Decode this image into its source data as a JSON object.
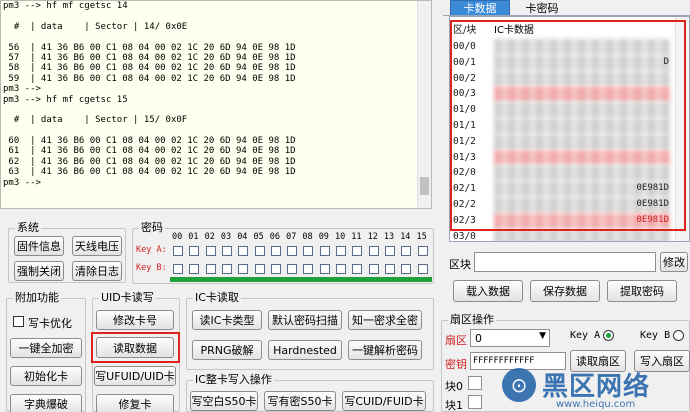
{
  "terminal": {
    "lines": [
      "pm3 --> hf mf cgetsc 14",
      "",
      "  #  | data    | Sector | 14/ 0x0E",
      "",
      " 56  | 41 36 B6 00 C1 08 04 00 02 1C 20 6D 94 0E 98 1D",
      " 57  | 41 36 B6 00 C1 08 04 00 02 1C 20 6D 94 0E 98 1D",
      " 58  | 41 36 B6 00 C1 08 04 00 02 1C 20 6D 94 0E 98 1D",
      " 59  | 41 36 B6 00 C1 08 04 00 02 1C 20 6D 94 0E 98 1D",
      "pm3 -->",
      "pm3 --> hf mf cgetsc 15",
      "",
      "  #  | data    | Sector | 15/ 0x0F",
      "",
      " 60  | 41 36 B6 00 C1 08 04 00 02 1C 20 6D 94 0E 98 1D",
      " 61  | 41 36 B6 00 C1 08 04 00 02 1C 20 6D 94 0E 98 1D",
      " 62  | 41 36 B6 00 C1 08 04 00 02 1C 20 6D 94 0E 98 1D",
      " 63  | 41 36 B6 00 C1 08 04 00 02 1C 20 6D 94 0E 98 1D",
      "pm3 -->",
      ""
    ]
  },
  "system": {
    "title": "系统",
    "btn_firmware": "固件信息",
    "btn_antenna": "天线电压",
    "btn_forceclose": "强制关闭",
    "btn_clearlog": "清除日志"
  },
  "password": {
    "title": "密码",
    "numbers": [
      "00",
      "01",
      "02",
      "03",
      "04",
      "05",
      "06",
      "07",
      "08",
      "09",
      "10",
      "11",
      "12",
      "13",
      "14",
      "15"
    ],
    "key_a": "Key A:",
    "key_b": "Key B:"
  },
  "extra": {
    "title": "附加功能",
    "write_opt": "写卡优化",
    "btn_encrypt": "一键全加密",
    "btn_init": "初始化卡",
    "btn_dict": "字典爆破"
  },
  "uid": {
    "title": "UID卡读写",
    "btn_modify": "修改卡号",
    "btn_read": "读取数据",
    "btn_write_uid": "写UFUID/UID卡",
    "btn_repair": "修复卡"
  },
  "icread": {
    "title": "IC卡读取",
    "btn_type": "读IC卡类型",
    "btn_default": "默认密码扫描",
    "btn_known": "知一密求全密",
    "btn_prng": "PRNG破解",
    "btn_hardnested": "Hardnested",
    "btn_parse": "一键解析密码"
  },
  "icwrite": {
    "title": "IC整卡写入操作",
    "btn_blank": "写空白S50卡",
    "btn_pwd": "写有密S50卡",
    "btn_cuid": "写CUID/FUID卡"
  },
  "tabs": {
    "card_data": "卡数据",
    "card_key": "卡密码"
  },
  "cardtable": {
    "col_sector": "区/块",
    "col_data": "IC卡数据",
    "rows": [
      {
        "label": "00/0",
        "tail": "",
        "red": false
      },
      {
        "label": "00/1",
        "tail": "D",
        "red": false
      },
      {
        "label": "00/2",
        "tail": "",
        "red": false
      },
      {
        "label": "00/3",
        "tail": "",
        "red": true
      },
      {
        "label": "01/0",
        "tail": "",
        "red": false
      },
      {
        "label": "01/1",
        "tail": "",
        "red": false
      },
      {
        "label": "01/2",
        "tail": "",
        "red": false
      },
      {
        "label": "01/3",
        "tail": "",
        "red": true
      },
      {
        "label": "02/0",
        "tail": "",
        "red": false
      },
      {
        "label": "02/1",
        "tail": "0E981D",
        "red": false
      },
      {
        "label": "02/2",
        "tail": "0E981D",
        "red": false
      },
      {
        "label": "02/3",
        "tail": "0E981D",
        "red": true
      },
      {
        "label": "03/0",
        "tail": "",
        "red": false
      }
    ]
  },
  "block": {
    "label": "区块",
    "btn_modify": "修改"
  },
  "actions": {
    "btn_load": "载入数据",
    "btn_save": "保存数据",
    "btn_extract": "提取密码"
  },
  "sector_op": {
    "title": "扇区操作",
    "sector_label": "扇区",
    "sector_value": "0",
    "key_a": "Key A",
    "key_b": "Key B",
    "key_label": "密钥",
    "key_value": "FFFFFFFFFFFF",
    "btn_read_sector": "读取扇区",
    "btn_write_sector": "写入扇区",
    "block0": "块0",
    "block1": "块1"
  },
  "watermark": {
    "brand": "黑区网络",
    "url": "www.heiqu.com"
  },
  "colors": {
    "highlight": "#e0221c",
    "progress": "#1fa03a",
    "tab_active": "#3b8bd8"
  }
}
